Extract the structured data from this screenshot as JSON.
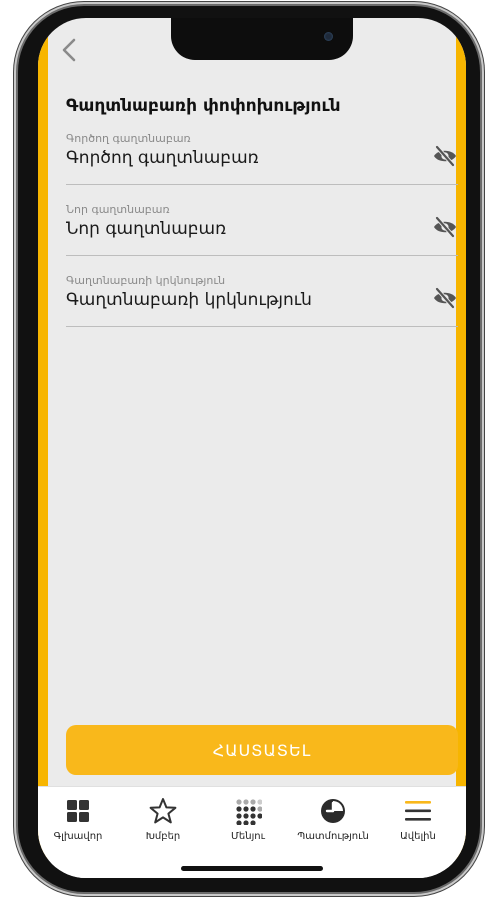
{
  "header": {
    "title": "Գաղտնաբառի փոփոխություն"
  },
  "fields": [
    {
      "label": "Գործող գաղտնաբառ",
      "placeholder": "Գործող գաղտնաբառ"
    },
    {
      "label": "Նոր գաղտնաբառ",
      "placeholder": "Նոր գաղտնաբառ"
    },
    {
      "label": "Գաղտնաբառի կրկնություն",
      "placeholder": "Գաղտնաբառի կրկնություն"
    }
  ],
  "save_button": {
    "label": "ՀԱՍՏԱՏԵԼ"
  },
  "tabbar": {
    "items": [
      {
        "label": "Գլխավոր",
        "icon": "grid-icon"
      },
      {
        "label": "Խմբեր",
        "icon": "star-icon"
      },
      {
        "label": "Մենյու",
        "icon": "dots-menu-icon"
      },
      {
        "label": "Պատմություն",
        "icon": "clock-icon"
      },
      {
        "label": "Ավելին",
        "icon": "hamburger-icon"
      }
    ]
  },
  "colors": {
    "accent": "#f9b81b",
    "edge_yellow": "#f7b500",
    "screen_bg": "#ebebeb",
    "text": "#111111"
  }
}
